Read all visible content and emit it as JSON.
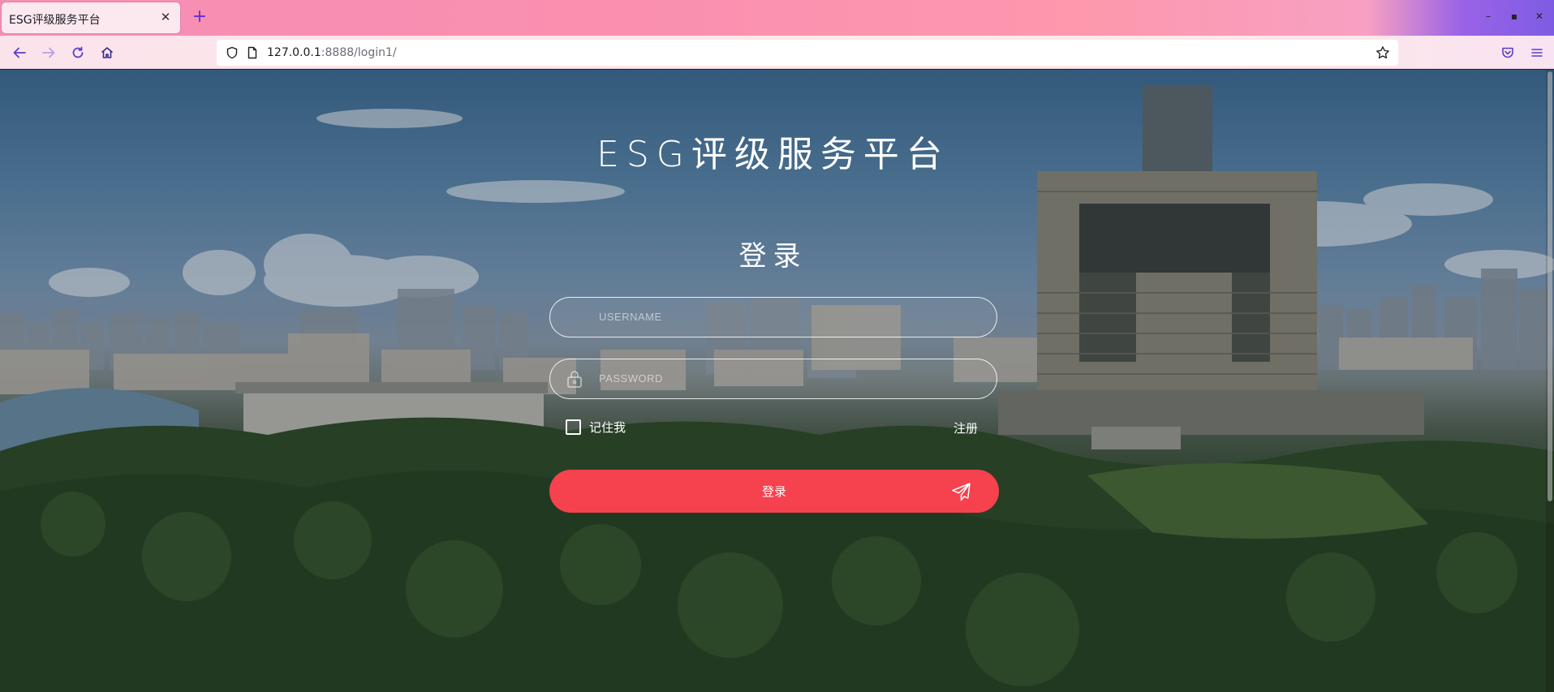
{
  "browser": {
    "tab_title": "ESG评级服务平台",
    "url_host": "127.0.0.1",
    "url_rest": ":8888/login1/"
  },
  "page": {
    "site_title": "ESG评级服务平台",
    "login_heading": "登录",
    "username_placeholder": "USERNAME",
    "password_placeholder": "PASSWORD",
    "remember_label": "记住我",
    "register_label": "注册",
    "login_button_label": "登录"
  },
  "colors": {
    "login_button": "#f5424e",
    "tab_accent": "#6a2ccf"
  }
}
